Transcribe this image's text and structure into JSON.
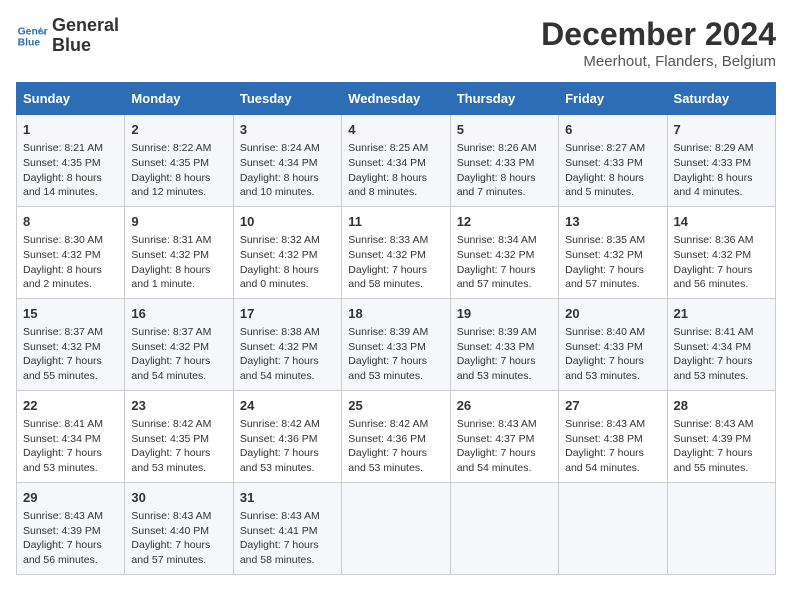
{
  "header": {
    "logo_line1": "General",
    "logo_line2": "Blue",
    "main_title": "December 2024",
    "subtitle": "Meerhout, Flanders, Belgium"
  },
  "calendar": {
    "days_of_week": [
      "Sunday",
      "Monday",
      "Tuesday",
      "Wednesday",
      "Thursday",
      "Friday",
      "Saturday"
    ],
    "weeks": [
      [
        {
          "num": "1",
          "info": "Sunrise: 8:21 AM\nSunset: 4:35 PM\nDaylight: 8 hours\nand 14 minutes."
        },
        {
          "num": "2",
          "info": "Sunrise: 8:22 AM\nSunset: 4:35 PM\nDaylight: 8 hours\nand 12 minutes."
        },
        {
          "num": "3",
          "info": "Sunrise: 8:24 AM\nSunset: 4:34 PM\nDaylight: 8 hours\nand 10 minutes."
        },
        {
          "num": "4",
          "info": "Sunrise: 8:25 AM\nSunset: 4:34 PM\nDaylight: 8 hours\nand 8 minutes."
        },
        {
          "num": "5",
          "info": "Sunrise: 8:26 AM\nSunset: 4:33 PM\nDaylight: 8 hours\nand 7 minutes."
        },
        {
          "num": "6",
          "info": "Sunrise: 8:27 AM\nSunset: 4:33 PM\nDaylight: 8 hours\nand 5 minutes."
        },
        {
          "num": "7",
          "info": "Sunrise: 8:29 AM\nSunset: 4:33 PM\nDaylight: 8 hours\nand 4 minutes."
        }
      ],
      [
        {
          "num": "8",
          "info": "Sunrise: 8:30 AM\nSunset: 4:32 PM\nDaylight: 8 hours\nand 2 minutes."
        },
        {
          "num": "9",
          "info": "Sunrise: 8:31 AM\nSunset: 4:32 PM\nDaylight: 8 hours\nand 1 minute."
        },
        {
          "num": "10",
          "info": "Sunrise: 8:32 AM\nSunset: 4:32 PM\nDaylight: 8 hours\nand 0 minutes."
        },
        {
          "num": "11",
          "info": "Sunrise: 8:33 AM\nSunset: 4:32 PM\nDaylight: 7 hours\nand 58 minutes."
        },
        {
          "num": "12",
          "info": "Sunrise: 8:34 AM\nSunset: 4:32 PM\nDaylight: 7 hours\nand 57 minutes."
        },
        {
          "num": "13",
          "info": "Sunrise: 8:35 AM\nSunset: 4:32 PM\nDaylight: 7 hours\nand 57 minutes."
        },
        {
          "num": "14",
          "info": "Sunrise: 8:36 AM\nSunset: 4:32 PM\nDaylight: 7 hours\nand 56 minutes."
        }
      ],
      [
        {
          "num": "15",
          "info": "Sunrise: 8:37 AM\nSunset: 4:32 PM\nDaylight: 7 hours\nand 55 minutes."
        },
        {
          "num": "16",
          "info": "Sunrise: 8:37 AM\nSunset: 4:32 PM\nDaylight: 7 hours\nand 54 minutes."
        },
        {
          "num": "17",
          "info": "Sunrise: 8:38 AM\nSunset: 4:32 PM\nDaylight: 7 hours\nand 54 minutes."
        },
        {
          "num": "18",
          "info": "Sunrise: 8:39 AM\nSunset: 4:33 PM\nDaylight: 7 hours\nand 53 minutes."
        },
        {
          "num": "19",
          "info": "Sunrise: 8:39 AM\nSunset: 4:33 PM\nDaylight: 7 hours\nand 53 minutes."
        },
        {
          "num": "20",
          "info": "Sunrise: 8:40 AM\nSunset: 4:33 PM\nDaylight: 7 hours\nand 53 minutes."
        },
        {
          "num": "21",
          "info": "Sunrise: 8:41 AM\nSunset: 4:34 PM\nDaylight: 7 hours\nand 53 minutes."
        }
      ],
      [
        {
          "num": "22",
          "info": "Sunrise: 8:41 AM\nSunset: 4:34 PM\nDaylight: 7 hours\nand 53 minutes."
        },
        {
          "num": "23",
          "info": "Sunrise: 8:42 AM\nSunset: 4:35 PM\nDaylight: 7 hours\nand 53 minutes."
        },
        {
          "num": "24",
          "info": "Sunrise: 8:42 AM\nSunset: 4:36 PM\nDaylight: 7 hours\nand 53 minutes."
        },
        {
          "num": "25",
          "info": "Sunrise: 8:42 AM\nSunset: 4:36 PM\nDaylight: 7 hours\nand 53 minutes."
        },
        {
          "num": "26",
          "info": "Sunrise: 8:43 AM\nSunset: 4:37 PM\nDaylight: 7 hours\nand 54 minutes."
        },
        {
          "num": "27",
          "info": "Sunrise: 8:43 AM\nSunset: 4:38 PM\nDaylight: 7 hours\nand 54 minutes."
        },
        {
          "num": "28",
          "info": "Sunrise: 8:43 AM\nSunset: 4:39 PM\nDaylight: 7 hours\nand 55 minutes."
        }
      ],
      [
        {
          "num": "29",
          "info": "Sunrise: 8:43 AM\nSunset: 4:39 PM\nDaylight: 7 hours\nand 56 minutes."
        },
        {
          "num": "30",
          "info": "Sunrise: 8:43 AM\nSunset: 4:40 PM\nDaylight: 7 hours\nand 57 minutes."
        },
        {
          "num": "31",
          "info": "Sunrise: 8:43 AM\nSunset: 4:41 PM\nDaylight: 7 hours\nand 58 minutes."
        },
        {
          "num": "",
          "info": ""
        },
        {
          "num": "",
          "info": ""
        },
        {
          "num": "",
          "info": ""
        },
        {
          "num": "",
          "info": ""
        }
      ]
    ]
  }
}
